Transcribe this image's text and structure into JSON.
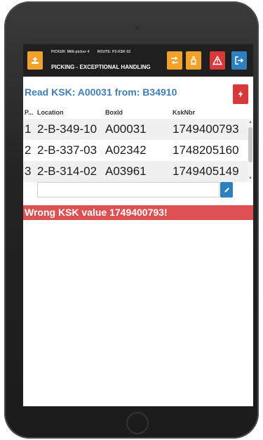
{
  "header": {
    "picker_label": "PICKER: M66-picker 4",
    "route_label": "ROUTE: P2-KSK 02",
    "title": "PICKING - EXCEPTIONAL HANDLING",
    "icons": {
      "logo": "upload-box-icon",
      "switch": "swap-arrows-icon",
      "hand": "hand-up-icon",
      "warning": "warning-triangle-icon",
      "logout": "logout-icon"
    }
  },
  "instruction": {
    "text": "Read KSK: A00031 from: B34910"
  },
  "table": {
    "columns": [
      "P...",
      "Location",
      "BoxId",
      "KskNbr"
    ],
    "rows": [
      {
        "pos": "1",
        "location": "2-B-349-10",
        "boxid": "A00031",
        "ksknbr": "1749400793"
      },
      {
        "pos": "2",
        "location": "2-B-337-03",
        "boxid": "A02342",
        "ksknbr": "1748205160"
      },
      {
        "pos": "3",
        "location": "2-B-314-02",
        "boxid": "A03961",
        "ksknbr": "1749405149"
      }
    ]
  },
  "scan_input": {
    "value": "",
    "placeholder": ""
  },
  "error": {
    "message": "Wrong KSK value 1749400793!"
  },
  "colors": {
    "orange": "#f2a12a",
    "red": "#d9383a",
    "blue": "#2f7fc0",
    "instruction_text": "#3f7fb5",
    "error_bar": "#de5152"
  }
}
